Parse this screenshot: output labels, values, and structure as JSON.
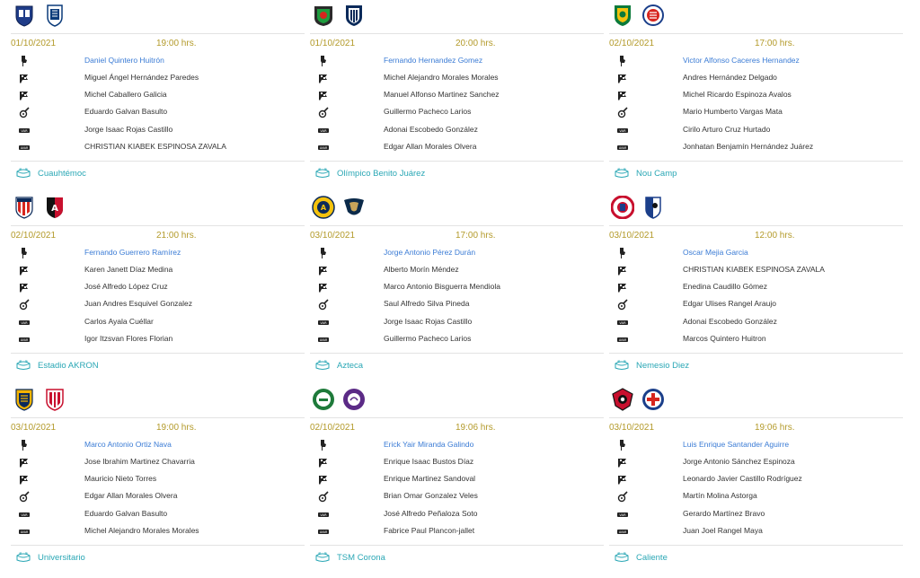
{
  "colors": {
    "accent_blue": "#3a7bd5",
    "date_gold": "#b39a2a",
    "stadium_teal": "#2aa7b5",
    "text": "#333333",
    "separator": "#e3e3e3"
  },
  "role_icons": [
    "referee-whistle-hand-icon",
    "assistant-flag-icon",
    "assistant-flag-icon",
    "fourth-official-whistle-icon",
    "var-icon",
    "avar-icon"
  ],
  "matches": [
    {
      "home_logo": "puebla-crest-icon",
      "away_logo": "pachuca-crest-icon",
      "date": "01/10/2021",
      "time": "19:00 hrs.",
      "officials": [
        "Daniel Quintero Huitrón",
        "Miguel Ángel Hernández Paredes",
        "Michel Caballero Galicia",
        "Eduardo Galvan Basulto",
        "Jorge Isaac Rojas Castillo",
        "CHRISTIAN KIABEK ESPINOSA ZAVALA"
      ],
      "stadium": "Cuauhtémoc"
    },
    {
      "home_logo": "juarez-crest-icon",
      "away_logo": "monterrey-crest-icon",
      "date": "01/10/2021",
      "time": "20:00 hrs.",
      "officials": [
        "Fernando Hernandez Gomez",
        "Michel Alejandro Morales Morales",
        "Manuel Alfonso Martinez Sanchez",
        "Guillermo Pacheco Larios",
        "Adonai Escobedo González",
        "Edgar Allan Morales Olvera"
      ],
      "stadium": "Olímpico Benito Juárez"
    },
    {
      "home_logo": "leon-crest-icon",
      "away_logo": "atletico-san-luis-crest-icon",
      "date": "02/10/2021",
      "time": "17:00 hrs.",
      "officials": [
        "Victor Alfonso Caceres Hernandez",
        "Andres Hernández Delgado",
        "Michel Ricardo Espinoza Avalos",
        "Mario Humberto Vargas Mata",
        "Cirilo Arturo Cruz Hurtado",
        "Jonhatan Benjamín Hernández Juárez"
      ],
      "stadium": "Nou Camp"
    },
    {
      "home_logo": "chivas-crest-icon",
      "away_logo": "atlas-crest-icon",
      "date": "02/10/2021",
      "time": "21:00 hrs.",
      "officials": [
        "Fernando Guerrero Ramírez",
        "Karen Janett Díaz Medina",
        "José Alfredo López Cruz",
        "Juan Andres Esquivel Gonzalez",
        "Carlos Ayala Cuéllar",
        "Igor Itzsvan Flores Florian"
      ],
      "stadium": "Estadio AKRON"
    },
    {
      "home_logo": "america-crest-icon",
      "away_logo": "pumas-crest-icon",
      "date": "03/10/2021",
      "time": "17:00 hrs.",
      "officials": [
        "Jorge Antonio Pérez Durán",
        "Alberto Morín Méndez",
        "Marco Antonio Bisguerra Mendiola",
        "Saul Alfredo Silva Pineda",
        "Jorge Isaac Rojas Castillo",
        "Guillermo Pacheco Larios"
      ],
      "stadium": "Azteca"
    },
    {
      "home_logo": "toluca-crest-icon",
      "away_logo": "queretaro-crest-icon",
      "date": "03/10/2021",
      "time": "12:00 hrs.",
      "officials": [
        "Oscar Mejia Garcia",
        "CHRISTIAN KIABEK ESPINOSA ZAVALA",
        "Enedina Caudillo Gómez",
        "Edgar Ulises Rangel Araujo",
        "Adonai Escobedo González",
        "Marcos Quintero Huitron"
      ],
      "stadium": "Nemesio Diez"
    },
    {
      "home_logo": "tigres-crest-icon",
      "away_logo": "necaxa-crest-icon",
      "date": "03/10/2021",
      "time": "19:00 hrs.",
      "officials": [
        "Marco Antonio Ortiz Nava",
        "Jose Ibrahim Martinez Chavarria",
        "Mauricio Nieto Torres",
        "Edgar Allan Morales Olvera",
        "Eduardo Galvan Basulto",
        "Michel Alejandro Morales Morales"
      ],
      "stadium": "Universitario"
    },
    {
      "home_logo": "santos-crest-icon",
      "away_logo": "mazatlan-crest-icon",
      "date": "02/10/2021",
      "time": "19:06 hrs.",
      "officials": [
        "Erick Yair Miranda Galindo",
        "Enrique Isaac Bustos Díaz",
        "Enrique Martinez Sandoval",
        "Brian Omar Gonzalez Veles",
        "José Alfredo Peñaloza Soto",
        "Fabrice Paul Plancon-jallet"
      ],
      "stadium": "TSM Corona"
    },
    {
      "home_logo": "tijuana-crest-icon",
      "away_logo": "cruz-azul-crest-icon",
      "date": "03/10/2021",
      "time": "19:06 hrs.",
      "officials": [
        "Luis Enrique Santander Aguirre",
        "Jorge Antonio Sánchez Espinoza",
        "Leonardo Javier Castillo Rodríguez",
        "Martín Molina Astorga",
        "Gerardo Martínez Bravo",
        "Juan Joel Rangel Maya"
      ],
      "stadium": "Caliente"
    }
  ]
}
